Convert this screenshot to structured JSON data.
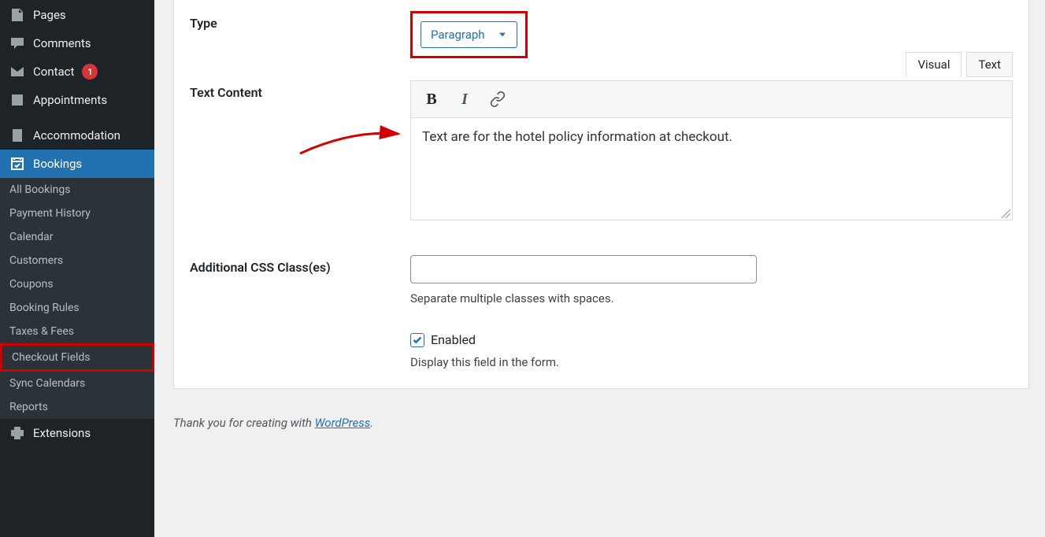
{
  "sidebar": {
    "pages": "Pages",
    "comments": "Comments",
    "contact": "Contact",
    "contact_badge": "1",
    "appointments": "Appointments",
    "accommodation": "Accommodation",
    "bookings": "Bookings",
    "sub": {
      "all_bookings": "All Bookings",
      "payment_history": "Payment History",
      "calendar": "Calendar",
      "customers": "Customers",
      "coupons": "Coupons",
      "booking_rules": "Booking Rules",
      "taxes_fees": "Taxes & Fees",
      "checkout_fields": "Checkout Fields",
      "sync_calendars": "Sync Calendars",
      "reports": "Reports"
    },
    "extensions": "Extensions"
  },
  "form": {
    "type_label": "Type",
    "type_value": "Paragraph",
    "text_content_label": "Text Content",
    "tabs": {
      "visual": "Visual",
      "text": "Text"
    },
    "toolbar_bold": "B",
    "toolbar_italic": "I",
    "editor_text": "Text are for the hotel policy information at checkout.",
    "css_label": "Additional CSS Class(es)",
    "css_value": "",
    "css_help": "Separate multiple classes with spaces.",
    "enabled_label": "Enabled",
    "enabled_help": "Display this field in the form."
  },
  "footer": {
    "pre": "Thank you for creating with ",
    "link": "WordPress",
    "post": "."
  }
}
